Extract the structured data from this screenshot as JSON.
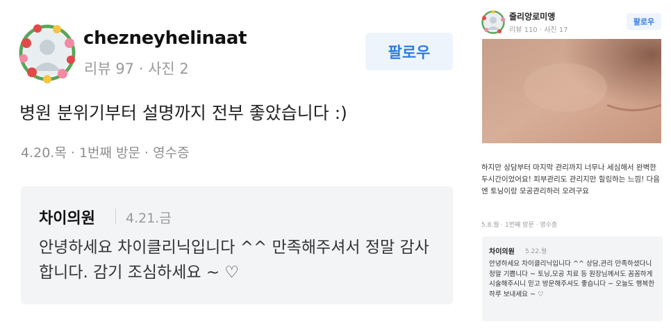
{
  "left_review": {
    "username": "chezneyhelinaat",
    "meta": "리뷰 97 · 사진 2",
    "follow_label": "팔로우",
    "text": "병원 분위기부터 설명까지 전부 좋았습니다 :)",
    "visit_info": "4.20.목 · 1번째 방문 · 영수증",
    "reply": {
      "author": "차이의원",
      "date": "4.21.금",
      "body": "안녕하세요 차이클리닉입니다 ^^ 만족해주셔서 정말 감사합니다. 감기 조심하세요 ~ ♡"
    }
  },
  "right_review": {
    "username": "줄리앙로미앵",
    "meta": "리뷰 110 · 사진 17",
    "follow_label": "팔로우",
    "text": "하지만 상담부터 마지막 관리까지 너무나 세심해서 완벽한 두시간이었어요! 피부관리도 관리지만 힐링하는 느낌! 다음엔 토닝이랑 모공관리하러 오려구요",
    "visit_info": "5.8.월 · 1번째 방문 · 영수증",
    "reply": {
      "author": "차이의원",
      "date": "5.22.월",
      "body": "안녕하세요 차이클리닉입니다 ^^ 상담,관리 만족하셨다니 정말 기쁩니다 ~ 토닝,모공 치료 등 원장님께서도 꼼꼼하게 시술해주시니 믿고 방문해주셔도 좋습니다 ~ 오늘도 행복한 하루 보내세요 ~ ♡"
    }
  },
  "icons": {
    "avatar": "flower-wreath-avatar-icon",
    "photo": "skin-closeup-photo"
  },
  "colors": {
    "accent": "#2f7ce0",
    "follow_bg": "#eef4fb",
    "reply_bg": "#f3f4f6",
    "muted": "#9a9a9a"
  }
}
